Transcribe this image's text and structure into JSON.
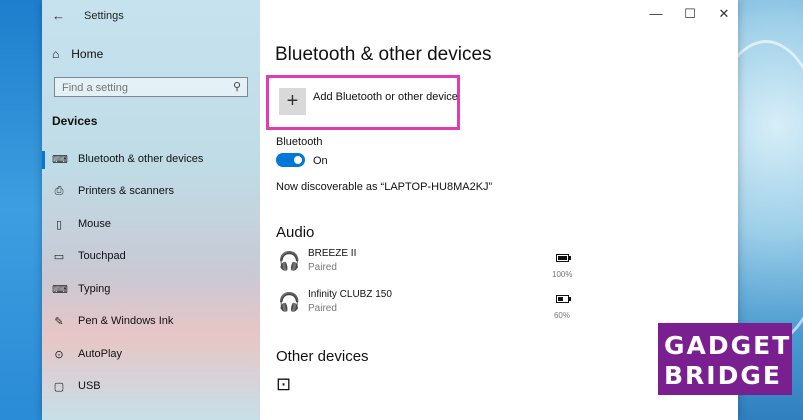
{
  "window": {
    "title": "Settings",
    "controls": {
      "minimize": "—",
      "maximize": "☐",
      "close": "✕"
    }
  },
  "sidebar": {
    "home_label": "Home",
    "search_placeholder": "Find a setting",
    "section_label": "Devices",
    "items": [
      {
        "label": "Bluetooth & other devices",
        "icon": "bluetooth-devices-icon",
        "selected": true
      },
      {
        "label": "Printers & scanners",
        "icon": "printer-icon"
      },
      {
        "label": "Mouse",
        "icon": "mouse-icon"
      },
      {
        "label": "Touchpad",
        "icon": "touchpad-icon"
      },
      {
        "label": "Typing",
        "icon": "keyboard-icon"
      },
      {
        "label": "Pen & Windows Ink",
        "icon": "pen-icon"
      },
      {
        "label": "AutoPlay",
        "icon": "autoplay-icon"
      },
      {
        "label": "USB",
        "icon": "usb-icon"
      }
    ]
  },
  "main": {
    "title": "Bluetooth & other devices",
    "add_device_label": "Add Bluetooth or other device",
    "bluetooth_label": "Bluetooth",
    "bluetooth_state": "On",
    "discoverable_text": "Now discoverable as “LAPTOP-HU8MA2KJ”",
    "audio_heading": "Audio",
    "audio_devices": [
      {
        "name": "BREEZE II",
        "status": "Paired",
        "battery": "100%",
        "battery_level": 1.0
      },
      {
        "name": "Infinity CLUBZ 150",
        "status": "Paired",
        "battery": "60%",
        "battery_level": 0.6
      }
    ],
    "other_heading": "Other devices"
  },
  "logo": {
    "line1": "GADGET",
    "line2": "BRIDGE",
    "color": "#7a1f8f"
  },
  "colors": {
    "accent": "#0078d7",
    "highlight_border": "#e03cb4"
  }
}
